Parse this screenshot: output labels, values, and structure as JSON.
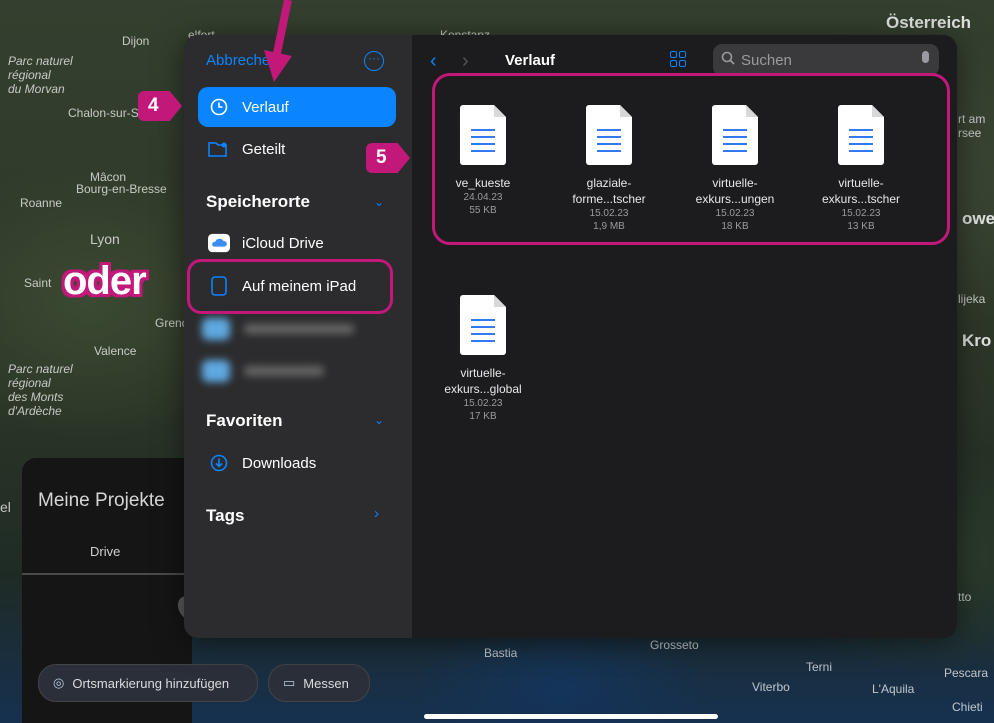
{
  "map": {
    "labels": [
      "Parc naturel régional du Morvan",
      "Dijon",
      "Chalon-sur-S",
      "Mâcon",
      "Bourg-en-Bresse",
      "Roanne",
      "Lyon",
      "Saint",
      "Grenc",
      "Valence",
      "Parc naturel régional des Monts d'Ardèche",
      "Konstanz",
      "Österreich",
      "rt am rsee",
      "owe",
      "lijeka",
      "Kro",
      "tto",
      "Bastia",
      "Grosseto",
      "Terni",
      "Viterbo",
      "L'Aquila",
      "Pescara",
      "Chieti",
      "elfort",
      "el"
    ]
  },
  "google_earth": {
    "title": "Meine Projekte",
    "tab": "Drive",
    "add_placemark": "Ortsmarkierung hinzufügen",
    "measure": "Messen"
  },
  "sidebar": {
    "cancel": "Abbrechen",
    "recents": "Verlauf",
    "shared": "Geteilt",
    "locations_header": "Speicherorte",
    "icloud": "iCloud Drive",
    "on_ipad": "Auf meinem iPad",
    "favorites_header": "Favoriten",
    "downloads": "Downloads",
    "tags_header": "Tags"
  },
  "main": {
    "title": "Verlauf",
    "search_placeholder": "Suchen",
    "files": [
      {
        "name": "ve_kueste",
        "date": "24.04.23",
        "size": "55 KB"
      },
      {
        "name": "glaziale-",
        "name2": "forme...tscher",
        "date": "15.02.23",
        "size": "1,9 MB"
      },
      {
        "name": "virtuelle-",
        "name2": "exkurs...ungen",
        "date": "15.02.23",
        "size": "18 KB"
      },
      {
        "name": "virtuelle-",
        "name2": "exkurs...tscher",
        "date": "15.02.23",
        "size": "13 KB"
      },
      {
        "name": "virtuelle-",
        "name2": "exkurs...global",
        "date": "15.02.23",
        "size": "17 KB"
      }
    ]
  },
  "annotations": {
    "step4": "4",
    "step5": "5",
    "oder": "oder",
    "accent": "#c2187a"
  }
}
